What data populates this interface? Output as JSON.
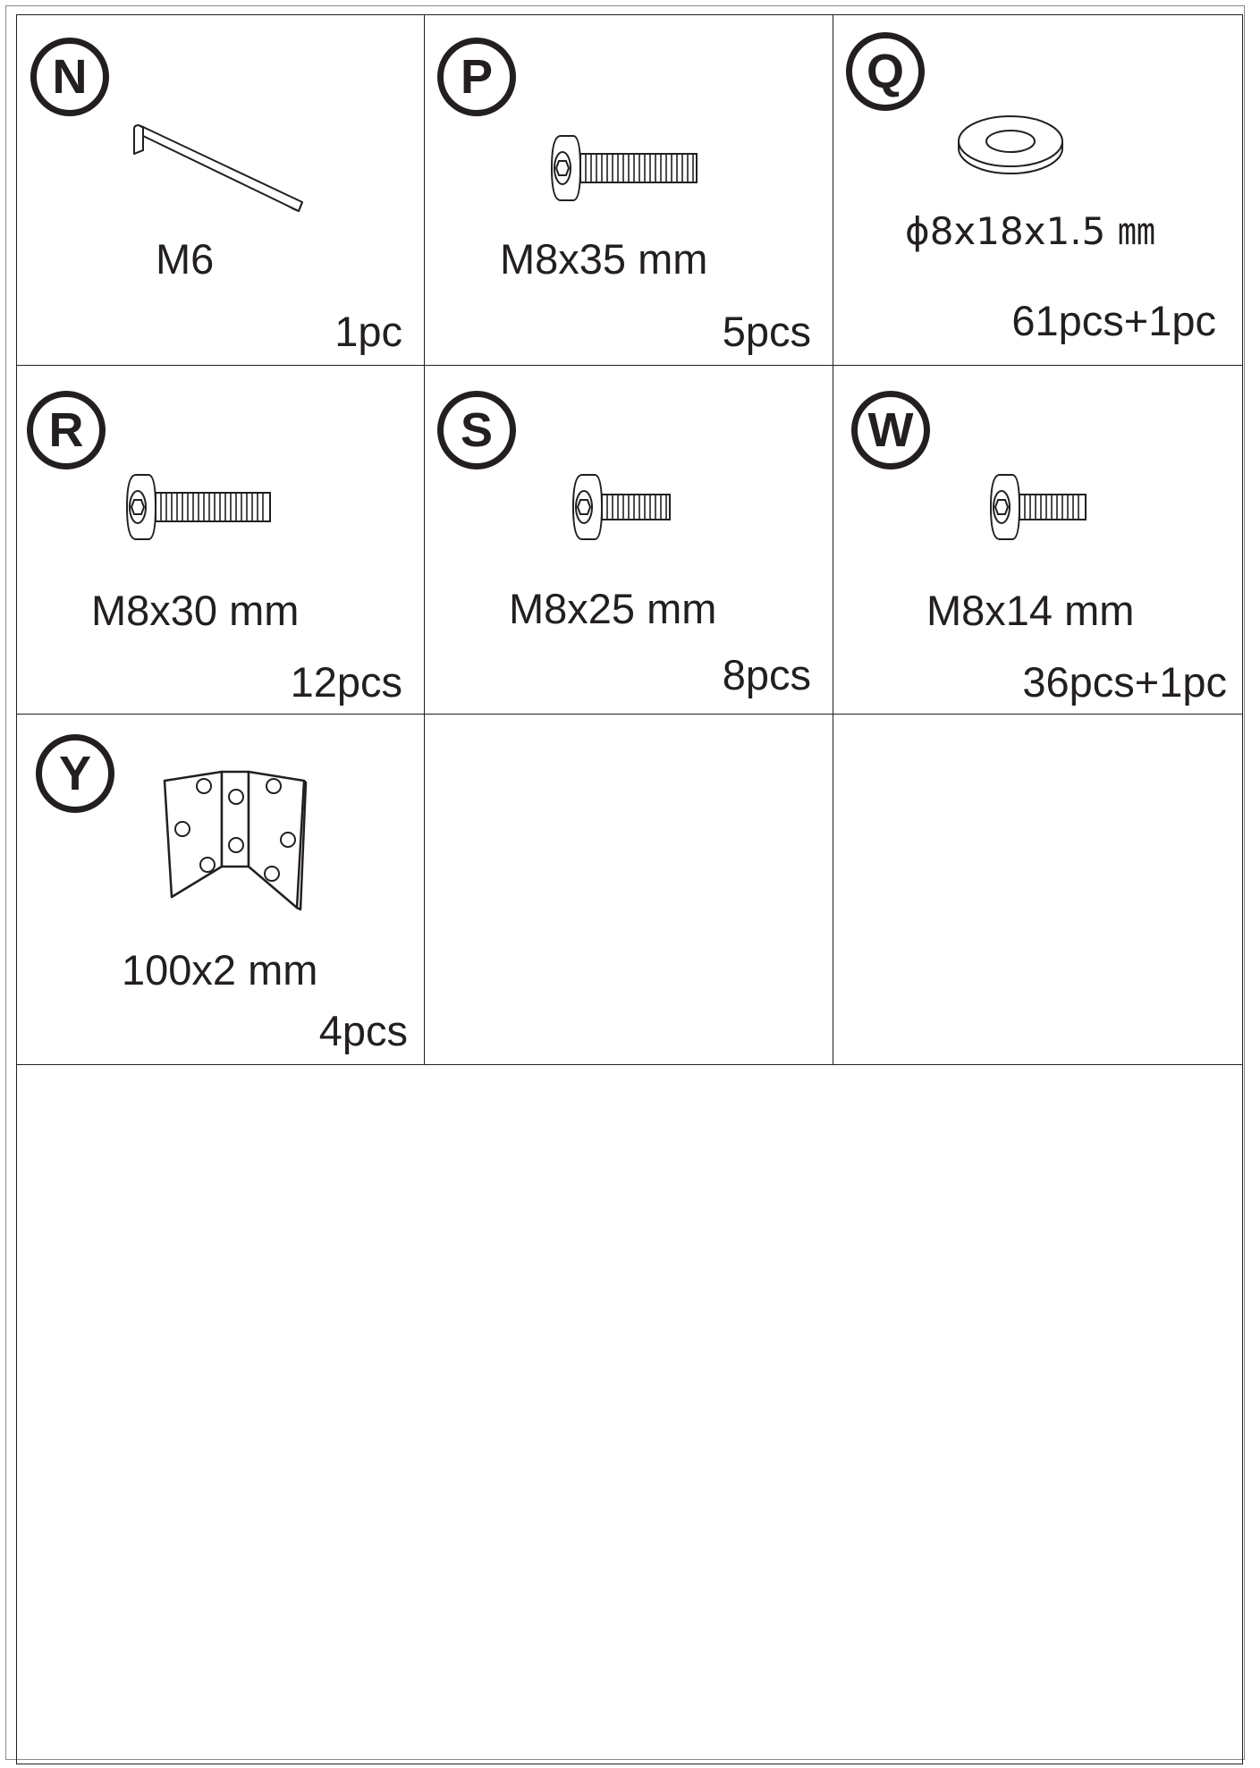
{
  "parts": [
    {
      "letter": "N",
      "spec": "M6",
      "qty": "1pc",
      "icon": "hex-key-icon"
    },
    {
      "letter": "P",
      "spec": "M8x35 mm",
      "qty": "5pcs",
      "icon": "bolt-icon"
    },
    {
      "letter": "Q",
      "spec": "ϕ8x18x1.5 ㎜",
      "qty": "61pcs+1pc",
      "icon": "washer-icon"
    },
    {
      "letter": "R",
      "spec": "M8x30 mm",
      "qty": "12pcs",
      "icon": "bolt-icon"
    },
    {
      "letter": "S",
      "spec": "M8x25 mm",
      "qty": "8pcs",
      "icon": "bolt-icon"
    },
    {
      "letter": "W",
      "spec": "M8x14 mm",
      "qty": "36pcs+1pc",
      "icon": "bolt-icon"
    },
    {
      "letter": "Y",
      "spec": "100x2 mm",
      "qty": "4pcs",
      "icon": "corner-bracket-icon"
    }
  ]
}
